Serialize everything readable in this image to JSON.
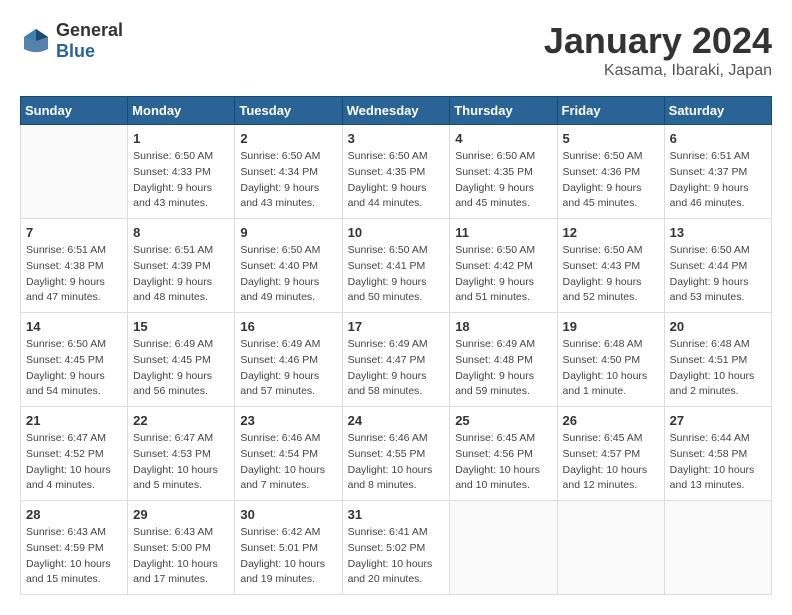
{
  "header": {
    "logo_general": "General",
    "logo_blue": "Blue",
    "month": "January 2024",
    "location": "Kasama, Ibaraki, Japan"
  },
  "weekdays": [
    "Sunday",
    "Monday",
    "Tuesday",
    "Wednesday",
    "Thursday",
    "Friday",
    "Saturday"
  ],
  "weeks": [
    [
      {
        "day": "",
        "sunrise": "",
        "sunset": "",
        "daylight": ""
      },
      {
        "day": "1",
        "sunrise": "Sunrise: 6:50 AM",
        "sunset": "Sunset: 4:33 PM",
        "daylight": "Daylight: 9 hours and 43 minutes."
      },
      {
        "day": "2",
        "sunrise": "Sunrise: 6:50 AM",
        "sunset": "Sunset: 4:34 PM",
        "daylight": "Daylight: 9 hours and 43 minutes."
      },
      {
        "day": "3",
        "sunrise": "Sunrise: 6:50 AM",
        "sunset": "Sunset: 4:35 PM",
        "daylight": "Daylight: 9 hours and 44 minutes."
      },
      {
        "day": "4",
        "sunrise": "Sunrise: 6:50 AM",
        "sunset": "Sunset: 4:35 PM",
        "daylight": "Daylight: 9 hours and 45 minutes."
      },
      {
        "day": "5",
        "sunrise": "Sunrise: 6:50 AM",
        "sunset": "Sunset: 4:36 PM",
        "daylight": "Daylight: 9 hours and 45 minutes."
      },
      {
        "day": "6",
        "sunrise": "Sunrise: 6:51 AM",
        "sunset": "Sunset: 4:37 PM",
        "daylight": "Daylight: 9 hours and 46 minutes."
      }
    ],
    [
      {
        "day": "7",
        "sunrise": "Sunrise: 6:51 AM",
        "sunset": "Sunset: 4:38 PM",
        "daylight": "Daylight: 9 hours and 47 minutes."
      },
      {
        "day": "8",
        "sunrise": "Sunrise: 6:51 AM",
        "sunset": "Sunset: 4:39 PM",
        "daylight": "Daylight: 9 hours and 48 minutes."
      },
      {
        "day": "9",
        "sunrise": "Sunrise: 6:50 AM",
        "sunset": "Sunset: 4:40 PM",
        "daylight": "Daylight: 9 hours and 49 minutes."
      },
      {
        "day": "10",
        "sunrise": "Sunrise: 6:50 AM",
        "sunset": "Sunset: 4:41 PM",
        "daylight": "Daylight: 9 hours and 50 minutes."
      },
      {
        "day": "11",
        "sunrise": "Sunrise: 6:50 AM",
        "sunset": "Sunset: 4:42 PM",
        "daylight": "Daylight: 9 hours and 51 minutes."
      },
      {
        "day": "12",
        "sunrise": "Sunrise: 6:50 AM",
        "sunset": "Sunset: 4:43 PM",
        "daylight": "Daylight: 9 hours and 52 minutes."
      },
      {
        "day": "13",
        "sunrise": "Sunrise: 6:50 AM",
        "sunset": "Sunset: 4:44 PM",
        "daylight": "Daylight: 9 hours and 53 minutes."
      }
    ],
    [
      {
        "day": "14",
        "sunrise": "Sunrise: 6:50 AM",
        "sunset": "Sunset: 4:45 PM",
        "daylight": "Daylight: 9 hours and 54 minutes."
      },
      {
        "day": "15",
        "sunrise": "Sunrise: 6:49 AM",
        "sunset": "Sunset: 4:45 PM",
        "daylight": "Daylight: 9 hours and 56 minutes."
      },
      {
        "day": "16",
        "sunrise": "Sunrise: 6:49 AM",
        "sunset": "Sunset: 4:46 PM",
        "daylight": "Daylight: 9 hours and 57 minutes."
      },
      {
        "day": "17",
        "sunrise": "Sunrise: 6:49 AM",
        "sunset": "Sunset: 4:47 PM",
        "daylight": "Daylight: 9 hours and 58 minutes."
      },
      {
        "day": "18",
        "sunrise": "Sunrise: 6:49 AM",
        "sunset": "Sunset: 4:48 PM",
        "daylight": "Daylight: 9 hours and 59 minutes."
      },
      {
        "day": "19",
        "sunrise": "Sunrise: 6:48 AM",
        "sunset": "Sunset: 4:50 PM",
        "daylight": "Daylight: 10 hours and 1 minute."
      },
      {
        "day": "20",
        "sunrise": "Sunrise: 6:48 AM",
        "sunset": "Sunset: 4:51 PM",
        "daylight": "Daylight: 10 hours and 2 minutes."
      }
    ],
    [
      {
        "day": "21",
        "sunrise": "Sunrise: 6:47 AM",
        "sunset": "Sunset: 4:52 PM",
        "daylight": "Daylight: 10 hours and 4 minutes."
      },
      {
        "day": "22",
        "sunrise": "Sunrise: 6:47 AM",
        "sunset": "Sunset: 4:53 PM",
        "daylight": "Daylight: 10 hours and 5 minutes."
      },
      {
        "day": "23",
        "sunrise": "Sunrise: 6:46 AM",
        "sunset": "Sunset: 4:54 PM",
        "daylight": "Daylight: 10 hours and 7 minutes."
      },
      {
        "day": "24",
        "sunrise": "Sunrise: 6:46 AM",
        "sunset": "Sunset: 4:55 PM",
        "daylight": "Daylight: 10 hours and 8 minutes."
      },
      {
        "day": "25",
        "sunrise": "Sunrise: 6:45 AM",
        "sunset": "Sunset: 4:56 PM",
        "daylight": "Daylight: 10 hours and 10 minutes."
      },
      {
        "day": "26",
        "sunrise": "Sunrise: 6:45 AM",
        "sunset": "Sunset: 4:57 PM",
        "daylight": "Daylight: 10 hours and 12 minutes."
      },
      {
        "day": "27",
        "sunrise": "Sunrise: 6:44 AM",
        "sunset": "Sunset: 4:58 PM",
        "daylight": "Daylight: 10 hours and 13 minutes."
      }
    ],
    [
      {
        "day": "28",
        "sunrise": "Sunrise: 6:43 AM",
        "sunset": "Sunset: 4:59 PM",
        "daylight": "Daylight: 10 hours and 15 minutes."
      },
      {
        "day": "29",
        "sunrise": "Sunrise: 6:43 AM",
        "sunset": "Sunset: 5:00 PM",
        "daylight": "Daylight: 10 hours and 17 minutes."
      },
      {
        "day": "30",
        "sunrise": "Sunrise: 6:42 AM",
        "sunset": "Sunset: 5:01 PM",
        "daylight": "Daylight: 10 hours and 19 minutes."
      },
      {
        "day": "31",
        "sunrise": "Sunrise: 6:41 AM",
        "sunset": "Sunset: 5:02 PM",
        "daylight": "Daylight: 10 hours and 20 minutes."
      },
      {
        "day": "",
        "sunrise": "",
        "sunset": "",
        "daylight": ""
      },
      {
        "day": "",
        "sunrise": "",
        "sunset": "",
        "daylight": ""
      },
      {
        "day": "",
        "sunrise": "",
        "sunset": "",
        "daylight": ""
      }
    ]
  ]
}
